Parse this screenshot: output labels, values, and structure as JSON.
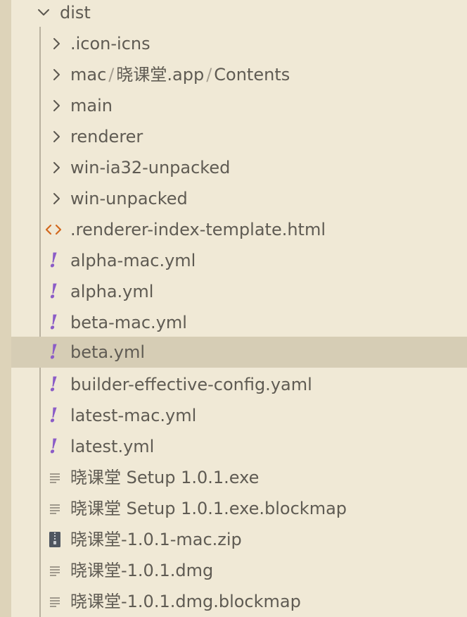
{
  "explorer": {
    "root": {
      "label": "dist",
      "icon": "chevron-down-icon",
      "expanded": true
    },
    "folders": [
      {
        "label": ".icon-icns",
        "icon": "chevron-right-icon"
      },
      {
        "label": "mac",
        "compact_path": [
          "mac",
          "晓课堂.app",
          "Contents"
        ],
        "icon": "chevron-right-icon"
      },
      {
        "label": "main",
        "icon": "chevron-right-icon"
      },
      {
        "label": "renderer",
        "icon": "chevron-right-icon"
      },
      {
        "label": "win-ia32-unpacked",
        "icon": "chevron-right-icon"
      },
      {
        "label": "win-unpacked",
        "icon": "chevron-right-icon"
      }
    ],
    "files": [
      {
        "label": ".renderer-index-template.html",
        "icon": "html-code-icon"
      },
      {
        "label": "alpha-mac.yml",
        "icon": "yaml-exclamation-icon"
      },
      {
        "label": "alpha.yml",
        "icon": "yaml-exclamation-icon"
      },
      {
        "label": "beta-mac.yml",
        "icon": "yaml-exclamation-icon"
      },
      {
        "label": "beta.yml",
        "icon": "yaml-exclamation-icon",
        "selected": true
      },
      {
        "label": "builder-effective-config.yaml",
        "icon": "yaml-exclamation-icon"
      },
      {
        "label": "latest-mac.yml",
        "icon": "yaml-exclamation-icon"
      },
      {
        "label": "latest.yml",
        "icon": "yaml-exclamation-icon"
      },
      {
        "label": "晓课堂 Setup 1.0.1.exe",
        "icon": "text-lines-icon"
      },
      {
        "label": "晓课堂 Setup 1.0.1.exe.blockmap",
        "icon": "text-lines-icon"
      },
      {
        "label": "晓课堂-1.0.1-mac.zip",
        "icon": "zip-archive-icon"
      },
      {
        "label": "晓课堂-1.0.1.dmg",
        "icon": "text-lines-icon"
      },
      {
        "label": "晓课堂-1.0.1.dmg.blockmap",
        "icon": "text-lines-icon"
      }
    ]
  },
  "colors": {
    "background": "#f0e9d6",
    "selected_row": "#d6cdb5",
    "yaml_icon": "#8b5cc7",
    "html_icon": "#d2691e"
  }
}
